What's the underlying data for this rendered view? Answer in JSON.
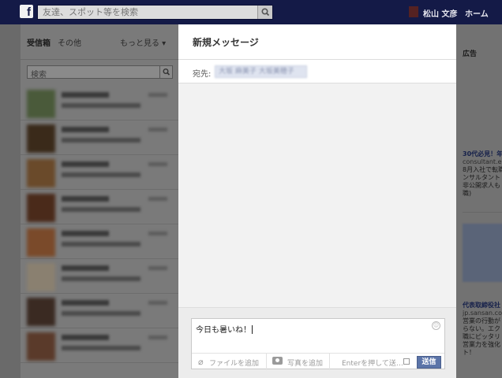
{
  "topbar": {
    "logo": "f",
    "search_placeholder": "友達、スポット等を検索",
    "profile_name": "松山 文彦",
    "home_label": "ホーム"
  },
  "left": {
    "tab_inbox": "受信箱",
    "tab_other": "その他",
    "tab_more": "もっと見る ▾",
    "search_placeholder": "検索"
  },
  "modal": {
    "title": "新規メッセージ",
    "to_label": "宛先:",
    "recipient": "大坂 麻美子 大坂美穂子",
    "message_text": "今日も暑いね！",
    "attach_label": "ファイルを追加",
    "photo_label": "写真を追加",
    "enter_label": "Enterを押して送…",
    "send_label": "送信"
  },
  "right": {
    "ad_label": "広告",
    "ad1_headline": "30代必見！年",
    "ad1_url": "consultant.en",
    "ad1_body": "8月入社で転職\nンサルタント\n非公開求人も\n職)",
    "ad2_headline": "代表取締役社",
    "ad2_url": "jp.sansan.com",
    "ad2_body": "営業の行動が\nらない。エク\n職にピッタリ\n営業力を強化\nト！"
  },
  "colors": {
    "topbar": "#141a47",
    "send_button": "#5b74a8"
  },
  "icons": [
    "facebook-logo-icon",
    "search-icon",
    "paperclip-icon",
    "camera-icon",
    "smiley-icon"
  ]
}
